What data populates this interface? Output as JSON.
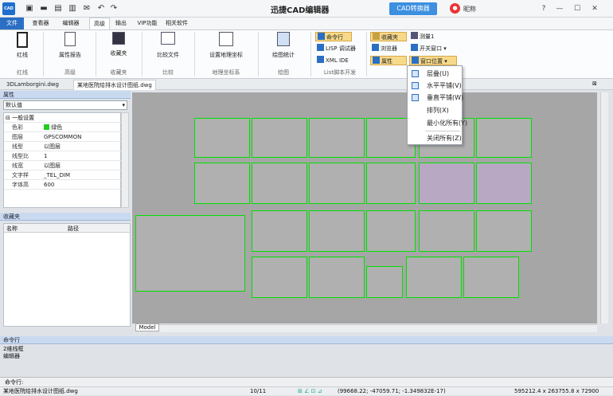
{
  "app": {
    "title": "迅捷CAD编辑器",
    "converter_button": "CAD转换器",
    "nickname": "昵称"
  },
  "ribbon": {
    "tabs": [
      "文件",
      "查看器",
      "编辑器",
      "高级",
      "输出",
      "VIP功能",
      "相关软件"
    ],
    "active_tab": "高级",
    "groups": {
      "red_line": {
        "button": "红线",
        "label": "红线"
      },
      "advanced": {
        "button": "属性报告",
        "label": "高级"
      },
      "favorites": {
        "button": "收藏夹",
        "label": "收藏夹"
      },
      "compare": {
        "button": "比较文件",
        "label": "比较"
      },
      "geo": {
        "button": "设置地理坐标",
        "label": "地理坐标系"
      },
      "drawing": {
        "button": "绘图统计",
        "label": "绘图"
      },
      "lisp": {
        "items": [
          "命令行",
          "LISP 调试器",
          "XML IDE"
        ],
        "label": "List脚本开发"
      },
      "window": {
        "items": [
          "收藏夹",
          "浏览器",
          "属性"
        ],
        "col2": [
          "测量1",
          "开关窗口",
          "窗口位置"
        ]
      }
    }
  },
  "window_menu": {
    "items": [
      "层叠(U)",
      "水平平铺(V)",
      "垂直平铺(W)",
      "排列(X)",
      "最小化所有(Y)",
      "关闭所有(Z)"
    ]
  },
  "doc_tabs": [
    "3DLamborgini.dwg",
    "某地医院给排水设计图纸.dwg"
  ],
  "properties": {
    "title": "属性",
    "select_value": "默认值",
    "section": "一般设置",
    "rows": [
      {
        "key": "色彩",
        "value": "绿色"
      },
      {
        "key": "图层",
        "value": "GPSCOMMON"
      },
      {
        "key": "线型",
        "value": "以图层"
      },
      {
        "key": "线型比",
        "value": "1"
      },
      {
        "key": "线宽",
        "value": "以图层"
      },
      {
        "key": "文字样",
        "value": "_TEL_DIM"
      },
      {
        "key": "字体高",
        "value": "600"
      }
    ],
    "color_swatch": "#22cc22"
  },
  "favorites": {
    "title": "收藏夹",
    "columns": [
      "名称",
      "路径"
    ]
  },
  "model_tab": "Model",
  "command": {
    "title": "命令行",
    "history": [
      "2维线框",
      "编辑器"
    ],
    "prompt": "命令行:"
  },
  "status": {
    "file": "某地医院给排水设计图纸.dwg",
    "page": "10/11",
    "coords": "(99668.22; -47059.71; -1.349832E-17)",
    "extents": "595212.4 x 263755.8 x 72900"
  },
  "colors": {
    "accent": "#2b6fc4",
    "sheet_border": "#00e000",
    "canvas": "#a6a6a6"
  }
}
